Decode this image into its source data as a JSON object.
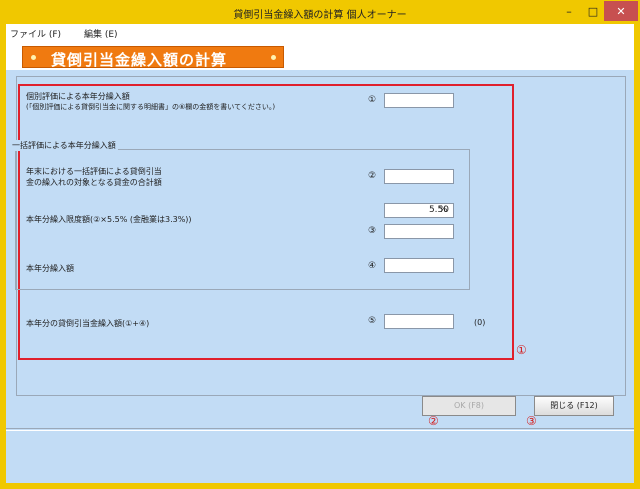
{
  "window": {
    "title": "貸倒引当金繰入額の計算 個人オーナー",
    "minimize_glyph": "–",
    "maximize_glyph": "□",
    "close_glyph": "✕"
  },
  "menu": {
    "items": [
      "ファイル (F)",
      "編集 (E)"
    ]
  },
  "header": {
    "title": "貸倒引当金繰入額の計算"
  },
  "form": {
    "row1": {
      "label_line1": "個別評価による本年分繰入額",
      "label_line2": "(「個別評価による貸倒引当金に関する明細書」の⑥欄の金額を書いてください。)",
      "num": "①",
      "value": ""
    },
    "group_title": "一括評価による本年分繰入額",
    "row2": {
      "label_line1": "年末における一括評価による貸倒引当",
      "label_line2": "金の繰入れの対象となる貸金の合計額",
      "num": "②",
      "value": ""
    },
    "rate": {
      "value": "5.50",
      "unit": "%"
    },
    "row3": {
      "label": "本年分繰入限度額(②×5.5% (金融業は3.3%))",
      "num": "③",
      "value": ""
    },
    "row4": {
      "label": "本年分繰入額",
      "num": "④",
      "value": ""
    },
    "row5": {
      "label": "本年分の貸倒引当金繰入額(①+④)",
      "num": "⑤",
      "value": "",
      "note": "(0)"
    }
  },
  "annotations": {
    "a1": "①",
    "a2": "②",
    "a3": "③"
  },
  "buttons": {
    "ok": "OK (F8)",
    "close": "閉じる (F12)"
  },
  "colors": {
    "frame": "#f0c800",
    "content_bg": "#c2dcf5",
    "banner": "#f07a10",
    "annotation_red": "#e0202c"
  }
}
